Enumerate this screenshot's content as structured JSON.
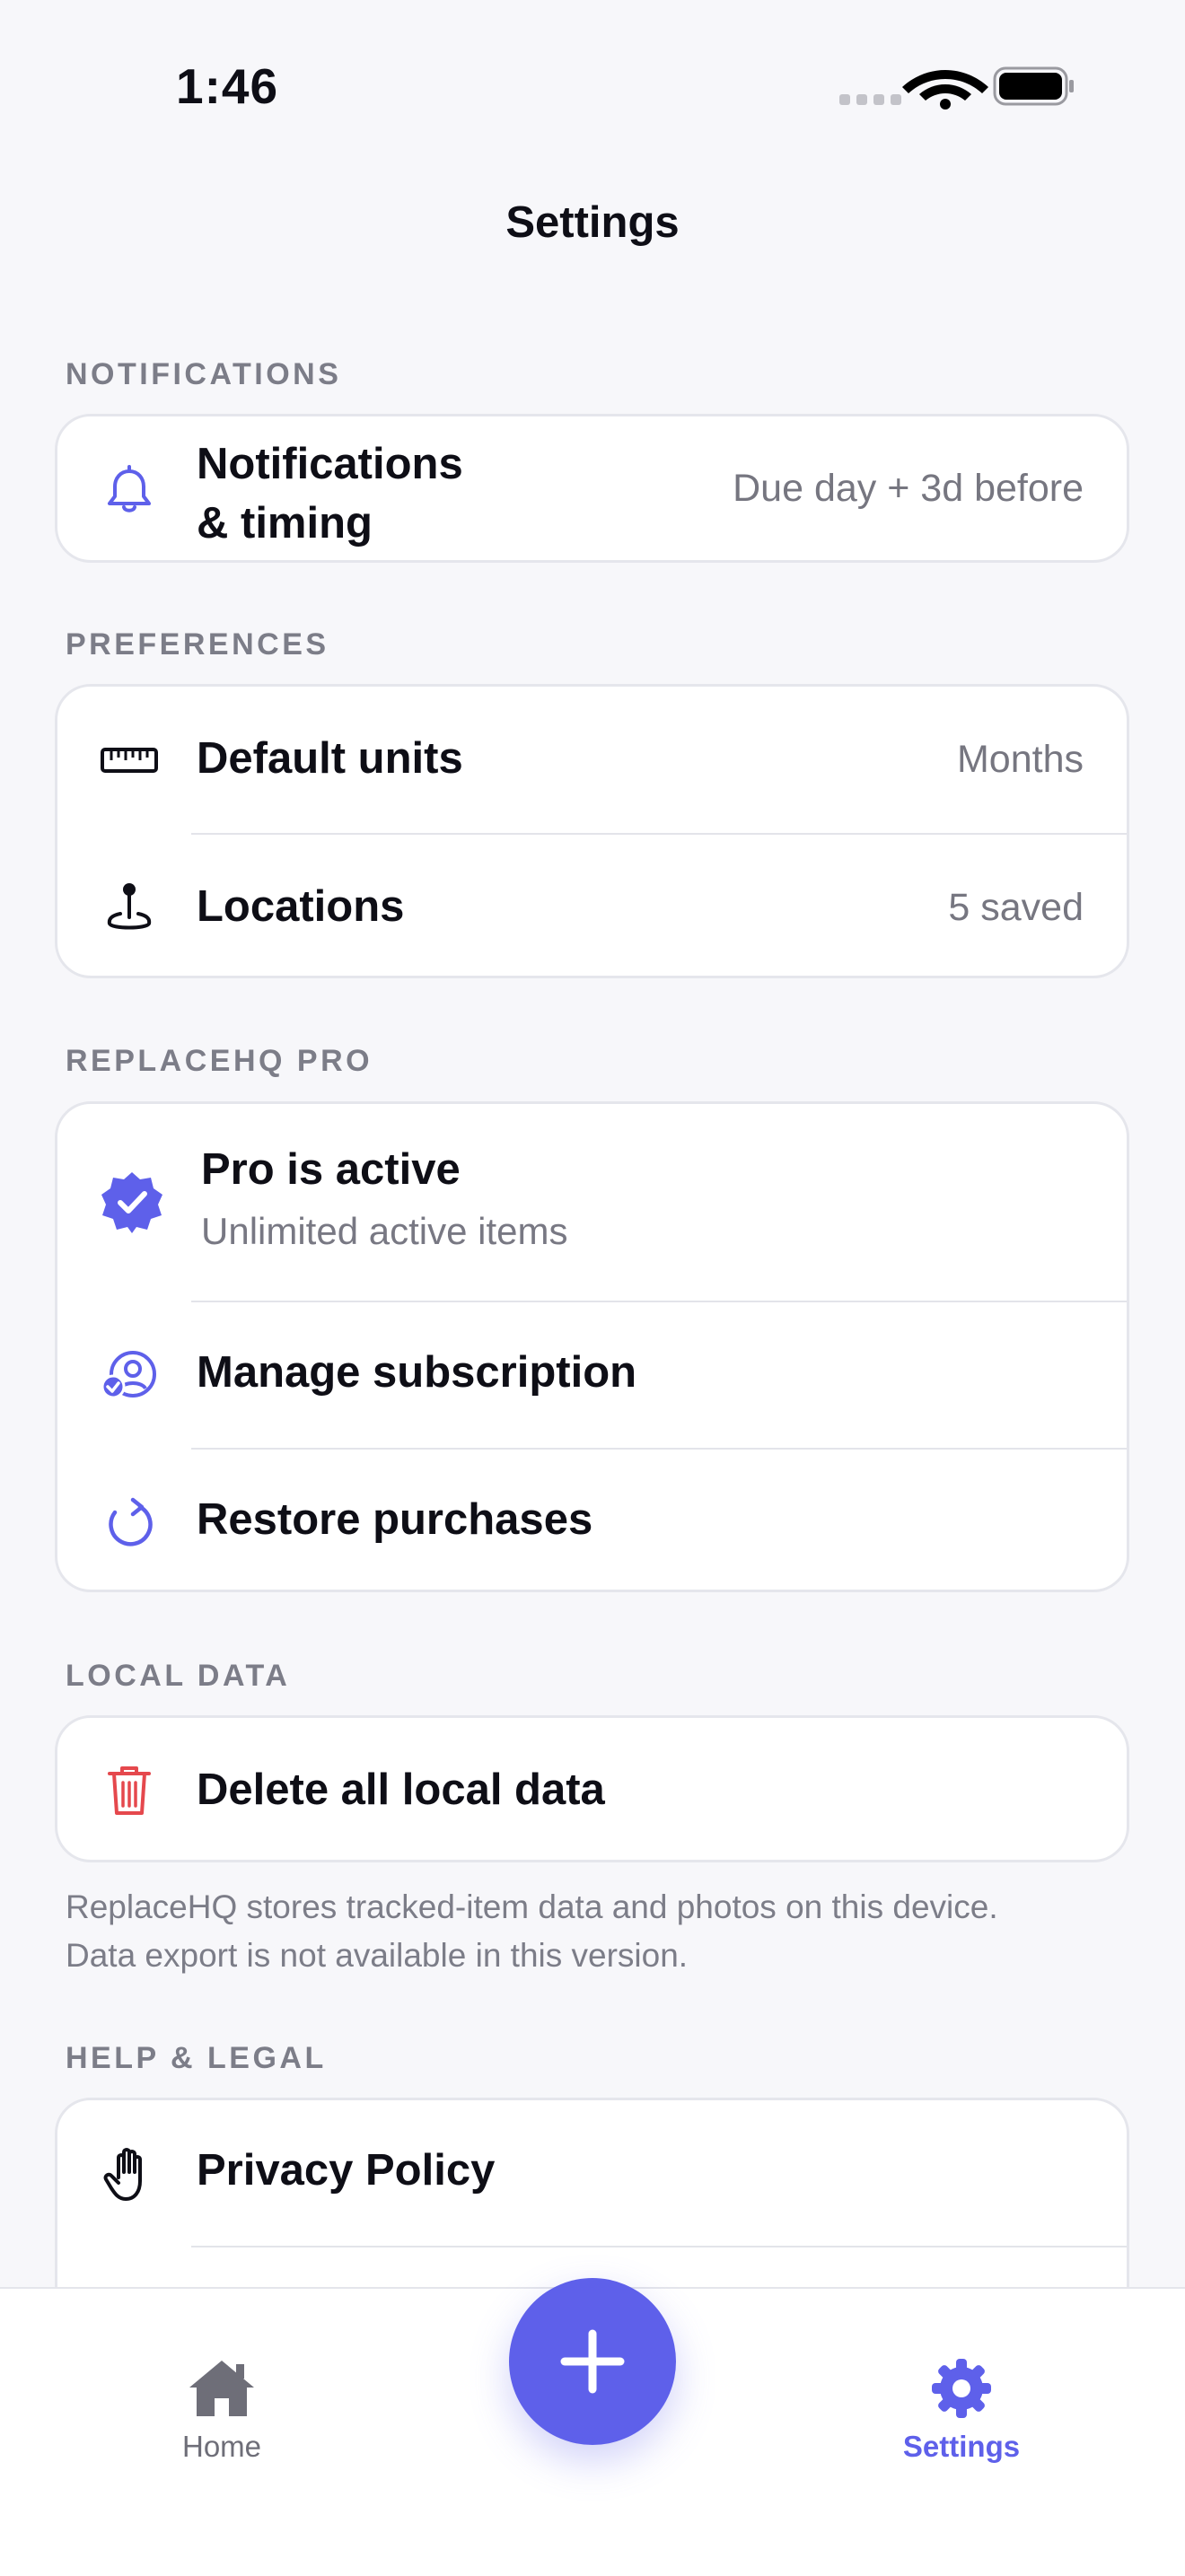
{
  "status_bar": {
    "time": "1:46"
  },
  "header": {
    "title": "Settings"
  },
  "sections": {
    "notifications": {
      "header": "NOTIFICATIONS",
      "rows": [
        {
          "title_line1": "Notifications",
          "title_line2": "& timing",
          "value": "Due day + 3d before",
          "icon": "bell-icon"
        }
      ]
    },
    "preferences": {
      "header": "PREFERENCES",
      "rows": [
        {
          "title": "Default units",
          "value": "Months",
          "icon": "ruler-icon"
        },
        {
          "title": "Locations",
          "value": "5 saved",
          "icon": "location-pin-icon"
        }
      ]
    },
    "pro": {
      "header": "REPLACEHQ PRO",
      "rows": [
        {
          "title": "Pro is active",
          "subtitle": "Unlimited active items",
          "icon": "verified-badge-icon"
        },
        {
          "title": "Manage subscription",
          "icon": "person-checkmark-icon"
        },
        {
          "title": "Restore purchases",
          "icon": "restore-arrow-icon"
        }
      ]
    },
    "local_data": {
      "header": "LOCAL DATA",
      "rows": [
        {
          "title": "Delete all local data",
          "icon": "trash-icon"
        }
      ],
      "footnote_line1": "ReplaceHQ stores tracked-item data and photos on this device.",
      "footnote_line2": "Data export is not available in this version."
    },
    "help_legal": {
      "header": "HELP & LEGAL",
      "rows": [
        {
          "title": "Privacy Policy",
          "icon": "hand-raised-icon"
        }
      ]
    }
  },
  "tab_bar": {
    "tabs": [
      {
        "label": "Home",
        "icon": "house-icon",
        "active": false
      },
      {
        "label": "Settings",
        "icon": "gear-icon",
        "active": true
      }
    ],
    "fab_icon": "plus-icon"
  },
  "colors": {
    "accent": "#5E60EA",
    "destructive": "#E5484D",
    "background": "#F7F7FA",
    "inactive_tab": "#6E6E78"
  }
}
